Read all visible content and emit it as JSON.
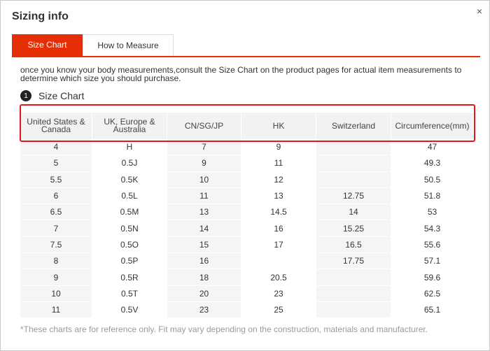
{
  "dialog": {
    "title": "Sizing info",
    "close_label": "×"
  },
  "tabs": [
    {
      "label": "Size Chart",
      "active": true
    },
    {
      "label": "How to Measure",
      "active": false
    }
  ],
  "intro_text": "once you know your body measurements,consult the Size Chart on the product pages for actual item measurements to determine which size you should purchase.",
  "section": {
    "number": "1",
    "title": "Size Chart"
  },
  "table": {
    "headers": [
      "United States & Canada",
      "UK, Europe & Australia",
      "CN/SG/JP",
      "HK",
      "Switzerland",
      "Circumference(mm)"
    ],
    "rows": [
      [
        "4",
        "H",
        "7",
        "9",
        "",
        "47"
      ],
      [
        "5",
        "0.5J",
        "9",
        "11",
        "",
        "49.3"
      ],
      [
        "5.5",
        "0.5K",
        "10",
        "12",
        "",
        "50.5"
      ],
      [
        "6",
        "0.5L",
        "11",
        "13",
        "12.75",
        "51.8"
      ],
      [
        "6.5",
        "0.5M",
        "13",
        "14.5",
        "14",
        "53"
      ],
      [
        "7",
        "0.5N",
        "14",
        "16",
        "15.25",
        "54.3"
      ],
      [
        "7.5",
        "0.5O",
        "15",
        "17",
        "16.5",
        "55.6"
      ],
      [
        "8",
        "0.5P",
        "16",
        "",
        "17.75",
        "57.1"
      ],
      [
        "9",
        "0.5R",
        "18",
        "20.5",
        "",
        "59.6"
      ],
      [
        "10",
        "0.5T",
        "20",
        "23",
        "",
        "62.5"
      ],
      [
        "11",
        "0.5V",
        "23",
        "25",
        "",
        "65.1"
      ]
    ]
  },
  "footnote": "*These charts are for reference only. Fit may vary depending on the construction, materials and manufacturer.",
  "colors": {
    "accent": "#e62e04",
    "highlight_border": "#e8141b"
  }
}
